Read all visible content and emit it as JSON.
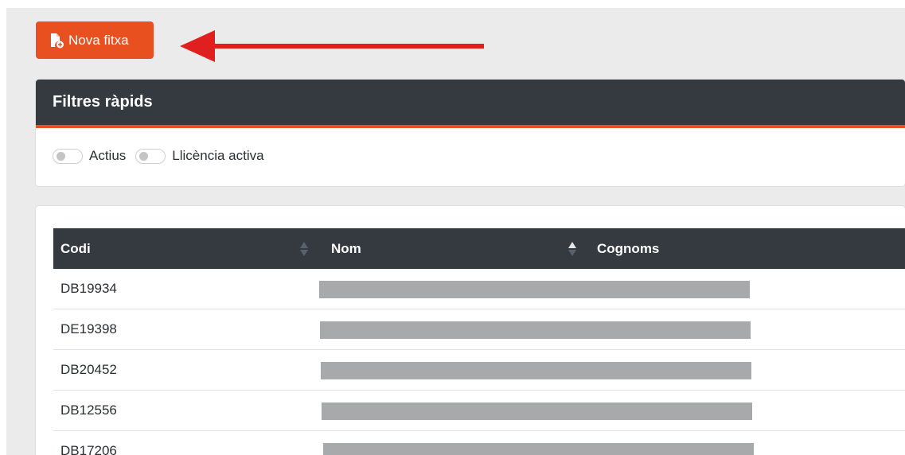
{
  "toolbar": {
    "new_label": "Nova fitxa",
    "icon": "file-add-icon"
  },
  "filters": {
    "title": "Filtres ràpids",
    "toggles": [
      {
        "label": "Actius",
        "on": false
      },
      {
        "label": "Llicència activa",
        "on": false
      }
    ]
  },
  "table": {
    "columns": [
      "Codi",
      "Nom",
      "Cognoms"
    ],
    "rows": [
      {
        "codi": "DB19934"
      },
      {
        "codi": "DE19398"
      },
      {
        "codi": "DB20452"
      },
      {
        "codi": "DB12556"
      },
      {
        "codi": "DB17206"
      }
    ]
  },
  "colors": {
    "accent": "#e8511f",
    "header_dark": "#343a40",
    "arrow": "#e02020",
    "redaction": "#a8a9ab"
  }
}
